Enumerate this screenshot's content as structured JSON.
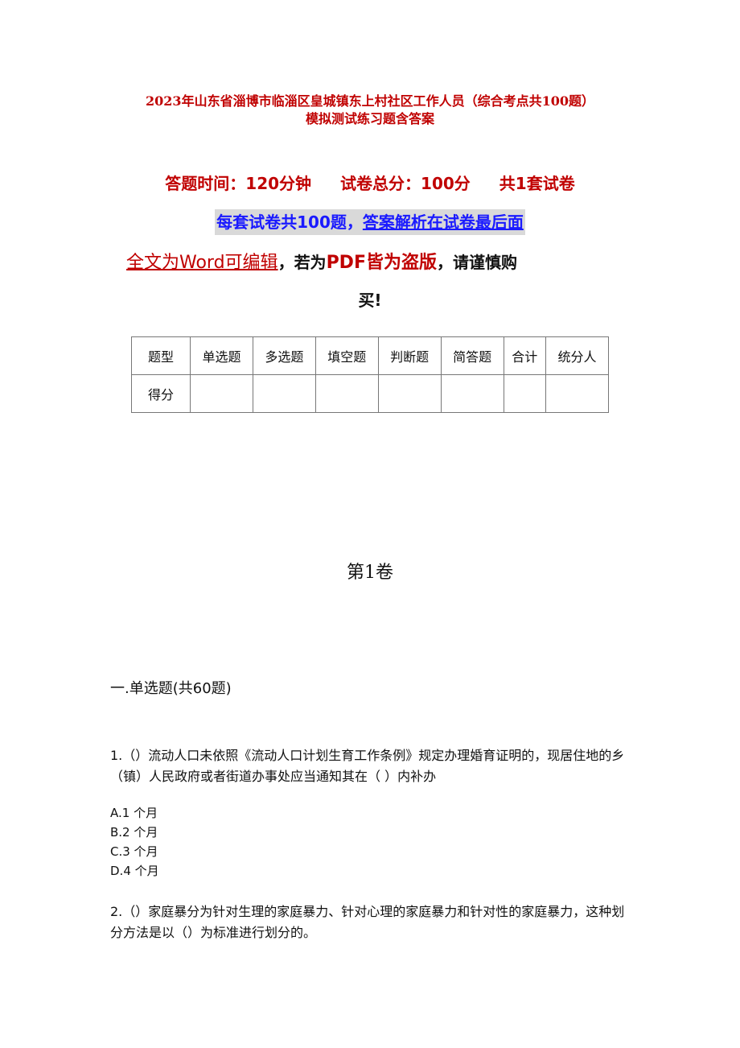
{
  "document": {
    "title_line1": "2023年山东省淄博市临淄区皇城镇东上村社区工作人员（综合考点共100题）",
    "title_line2": "模拟测试练习题含答案",
    "meta": {
      "time": "答题时间：120分钟",
      "total_score": "试卷总分：100分",
      "sets": "共1套试卷"
    },
    "notice": {
      "part1": "每套试卷共100题，",
      "part2": "答案解析在试卷最后面"
    },
    "editable_notice": {
      "part1": "全文为Word可编辑",
      "comma1": "，",
      "part2": "若为",
      "part3": "PDF皆为盗版",
      "comma2": "，",
      "part4": "请谨慎购",
      "part5": "买!"
    },
    "score_table": {
      "header": [
        "题型",
        "单选题",
        "多选题",
        "填空题",
        "判断题",
        "简答题",
        "合计",
        "统分人"
      ],
      "row": [
        "得分",
        "",
        "",
        "",
        "",
        "",
        "",
        ""
      ]
    },
    "volume_title": "第1卷",
    "section_title": "一.单选题(共60题)",
    "questions": [
      {
        "text": "1.（）流动人口未依照《流动人口计划生育工作条例》规定办理婚育证明的，现居住地的乡（镇）人民政府或者街道办事处应当通知其在（  ）内补办",
        "options": [
          "A.1  个月",
          "B.2  个月",
          "C.3  个月",
          "D.4  个月"
        ]
      },
      {
        "text": "2.（）家庭暴分为针对生理的家庭暴力、针对心理的家庭暴力和针对性的家庭暴力，这种划分方法是以（）为标准进行划分的。",
        "options": []
      }
    ],
    "colors": {
      "title_red": "#c00000",
      "notice_blue": "#1a1aff",
      "notice_bg": "#d9d9d9"
    }
  }
}
